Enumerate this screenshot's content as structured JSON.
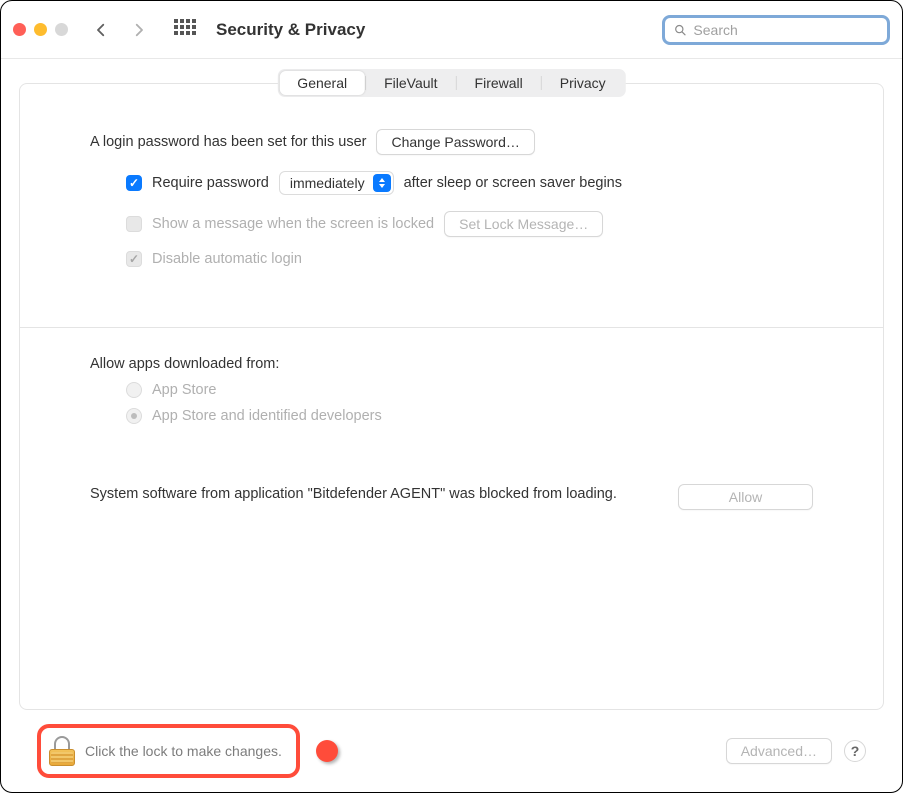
{
  "toolbar": {
    "title": "Security & Privacy",
    "search_placeholder": "Search"
  },
  "tabs": [
    {
      "label": "General",
      "active": true
    },
    {
      "label": "FileVault",
      "active": false
    },
    {
      "label": "Firewall",
      "active": false
    },
    {
      "label": "Privacy",
      "active": false
    }
  ],
  "general": {
    "login_password_text": "A login password has been set for this user",
    "change_password_label": "Change Password…",
    "require_password_label": "Require password",
    "require_password_delay": "immediately",
    "require_password_suffix": "after sleep or screen saver begins",
    "show_message_label": "Show a message when the screen is locked",
    "set_lock_message_label": "Set Lock Message…",
    "disable_auto_login_label": "Disable automatic login"
  },
  "downloads": {
    "heading": "Allow apps downloaded from:",
    "option1": "App Store",
    "option2": "App Store and identified developers"
  },
  "blocked": {
    "text": "System software from application \"Bitdefender AGENT\" was blocked from loading.",
    "allow_label": "Allow"
  },
  "footer": {
    "lock_text": "Click the lock to make changes.",
    "advanced_label": "Advanced…"
  }
}
